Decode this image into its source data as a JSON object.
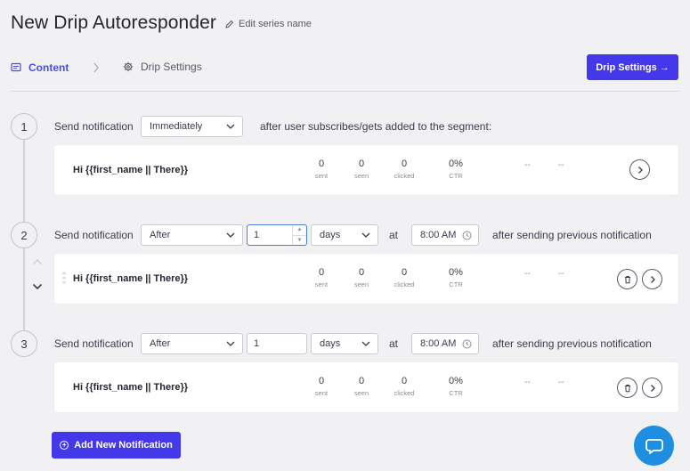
{
  "header": {
    "title": "New Drip Autoresponder",
    "edit_label": "Edit series name"
  },
  "tabs": {
    "content_label": "Content",
    "drip_label": "Drip Settings"
  },
  "drip_button_label": "Drip Settings →",
  "common": {
    "send_label": "Send notification",
    "at_label": "at",
    "after_previous_label": "after sending previous notification",
    "after_subscribe_label": "after user subscribes/gets added to the segment:",
    "stat_labels": [
      "sent",
      "seen",
      "clicked",
      "CTR"
    ],
    "dash": "--"
  },
  "steps": [
    {
      "number": "1",
      "timing": "Immediately",
      "title": "Hi {{first_name || There}}",
      "stats": [
        "0",
        "0",
        "0",
        "0%"
      ]
    },
    {
      "number": "2",
      "timing": "After",
      "amount": "1",
      "unit": "days",
      "time": "8:00 AM",
      "title": "Hi {{first_name || There}}",
      "stats": [
        "0",
        "0",
        "0",
        "0%"
      ]
    },
    {
      "number": "3",
      "timing": "After",
      "amount": "1",
      "unit": "days",
      "time": "8:00 AM",
      "title": "Hi {{first_name || There}}",
      "stats": [
        "0",
        "0",
        "0",
        "0%"
      ]
    }
  ],
  "add_button_label": "Add New Notification",
  "colors": {
    "accent": "#4338ea",
    "help": "#1e8fe0"
  }
}
